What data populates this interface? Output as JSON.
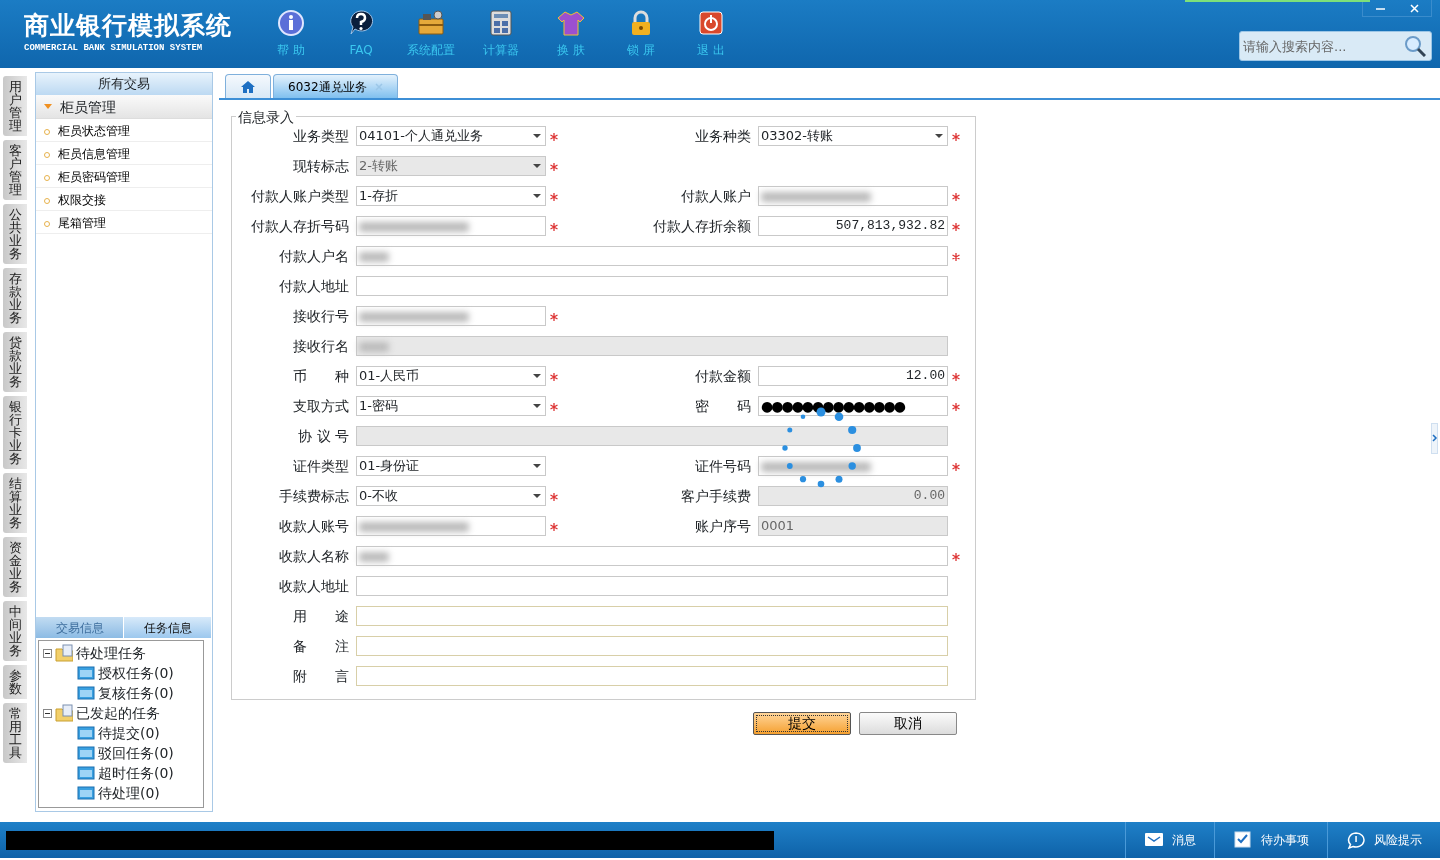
{
  "app": {
    "title": "商业银行模拟系统",
    "subtitle": "COMMERCIAL BANK SIMULATION SYSTEM"
  },
  "toolbar": [
    {
      "kind": "info",
      "label": "帮 助"
    },
    {
      "kind": "faq",
      "label": "FAQ"
    },
    {
      "kind": "toolbox",
      "label": "系统配置"
    },
    {
      "kind": "calc",
      "label": "计算器"
    },
    {
      "kind": "shirt",
      "label": "换 肤"
    },
    {
      "kind": "lock",
      "label": "锁 屏"
    },
    {
      "kind": "power",
      "label": "退 出"
    }
  ],
  "search": {
    "placeholder": "请输入搜索内容..."
  },
  "side_tabs": [
    "用户管理",
    "客户管理",
    "公共业务",
    "存款业务",
    "贷款业务",
    "银行卡业务",
    "结算业务",
    "资金业务",
    "中间业务",
    "参数",
    "常用工具"
  ],
  "sidebar": {
    "title": "所有交易",
    "group": {
      "label": "柜员管理",
      "expanded": true,
      "items": [
        "柜员状态管理",
        "柜员信息管理",
        "柜员密码管理",
        "权限交接",
        "尾箱管理"
      ]
    },
    "tabs": [
      {
        "label": "交易信息",
        "selected": false
      },
      {
        "label": "任务信息",
        "selected": true
      }
    ],
    "tree": [
      {
        "label": "待处理任务",
        "expanded": true,
        "children": [
          {
            "label": "授权任务(0)"
          },
          {
            "label": "复核任务(0)"
          }
        ]
      },
      {
        "label": "已发起的任务",
        "expanded": true,
        "children": [
          {
            "label": "待提交(0)"
          },
          {
            "label": "驳回任务(0)"
          },
          {
            "label": "超时任务(0)"
          },
          {
            "label": "待处理(0)"
          }
        ]
      }
    ]
  },
  "tabs": [
    {
      "kind": "home",
      "selected": false
    },
    {
      "kind": "page",
      "label": "6032通兑业务",
      "selected": true
    }
  ],
  "form": {
    "legend": "信息录入",
    "rows": [
      [
        {
          "label": "业务类型",
          "kind": "select",
          "value": "04101-个人通兑业务",
          "required": true
        },
        {
          "label": "业务种类",
          "kind": "select",
          "value": "03302-转账",
          "required": true
        }
      ],
      [
        {
          "label": "现转标志",
          "kind": "select",
          "value": "2-转账",
          "disabled": true,
          "required": true
        }
      ],
      [
        {
          "label": "付款人账户类型",
          "kind": "select",
          "value": "1-存折",
          "required": true
        },
        {
          "label": "付款人账户",
          "kind": "text",
          "blurred": true,
          "required": true
        }
      ],
      [
        {
          "label": "付款人存折号码",
          "kind": "text",
          "blurred": true,
          "required": true
        },
        {
          "label": "付款人存折余额",
          "kind": "number",
          "value": "507,813,932.82",
          "required": true
        }
      ],
      [
        {
          "label": "付款人户名",
          "kind": "wide",
          "blurred": true,
          "required": true
        }
      ],
      [
        {
          "label": "付款人地址",
          "kind": "wide"
        }
      ],
      [
        {
          "label": "接收行号",
          "kind": "text",
          "blurred": true,
          "required": true
        }
      ],
      [
        {
          "label": "接收行名",
          "kind": "wide",
          "blurred": true,
          "disabled": true
        }
      ],
      [
        {
          "label": "币　　种",
          "kind": "select",
          "value": "01-人民币",
          "required": true
        },
        {
          "label": "付款金额",
          "kind": "number",
          "value": "12.00",
          "required": true
        }
      ],
      [
        {
          "label": "支取方式",
          "kind": "select",
          "value": "1-密码",
          "required": true
        },
        {
          "label": "密　　码",
          "kind": "password",
          "value": "●●●●●●●●●●●●●●",
          "required": true
        }
      ],
      [
        {
          "label": "协 议 号",
          "kind": "wide",
          "disabled": true
        }
      ],
      [
        {
          "label": "证件类型",
          "kind": "select",
          "value": "01-身份证"
        },
        {
          "label": "证件号码",
          "kind": "text",
          "blurred": true,
          "required": true
        }
      ],
      [
        {
          "label": "手续费标志",
          "kind": "select",
          "value": "0-不收",
          "required": true
        },
        {
          "label": "客户手续费",
          "kind": "number",
          "value": "0.00",
          "disabled": true
        }
      ],
      [
        {
          "label": "收款人账号",
          "kind": "text",
          "blurred": true,
          "required": true
        },
        {
          "label": "账户序号",
          "kind": "text",
          "value": "0001",
          "disabled": true
        }
      ],
      [
        {
          "label": "收款人名称",
          "kind": "wide",
          "blurred": true,
          "required": true
        }
      ],
      [
        {
          "label": "收款人地址",
          "kind": "wide"
        }
      ],
      [
        {
          "label": "用　　途",
          "kind": "wide"
        }
      ],
      [
        {
          "label": "备　　注",
          "kind": "wide"
        }
      ],
      [
        {
          "label": "附　　言",
          "kind": "wide"
        }
      ]
    ]
  },
  "buttons": [
    {
      "label": "提交",
      "primary": true
    },
    {
      "label": "取消",
      "primary": false
    }
  ],
  "status_bar": [
    {
      "kind": "mail",
      "label": "消息"
    },
    {
      "kind": "check",
      "label": "待办事项"
    },
    {
      "kind": "bubble",
      "label": "风险提示"
    }
  ]
}
